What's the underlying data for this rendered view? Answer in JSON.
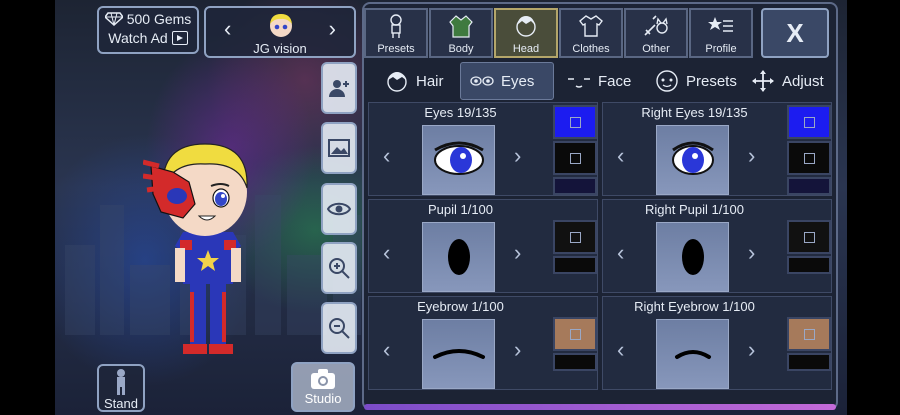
{
  "gems": {
    "count_label": "500 Gems",
    "watch_ad_label": "Watch Ad"
  },
  "character_selector": {
    "name": "JG vision"
  },
  "left_tools": [
    "add-character-icon",
    "background-image-icon",
    "visibility-eye-icon",
    "zoom-in-icon",
    "zoom-out-icon"
  ],
  "stand_label": "Stand",
  "studio_label": "Studio",
  "categories": [
    {
      "label": "Presets",
      "active": false
    },
    {
      "label": "Body",
      "active": false
    },
    {
      "label": "Head",
      "active": true
    },
    {
      "label": "Clothes",
      "active": false
    },
    {
      "label": "Other",
      "active": false
    },
    {
      "label": "Profile",
      "active": false
    }
  ],
  "close_label": "X",
  "subtabs": [
    {
      "label": "Hair",
      "active": false
    },
    {
      "label": "Eyes",
      "active": true
    },
    {
      "label": "Face",
      "active": false
    },
    {
      "label": "Presets",
      "active": false
    },
    {
      "label": "Adjust",
      "active": false
    }
  ],
  "cells": [
    {
      "title": "Eyes 19/135",
      "colors": [
        "#1c1cf0",
        "#0a0a0a",
        "#14143a"
      ]
    },
    {
      "title": "Right Eyes 19/135",
      "colors": [
        "#1c1cf0",
        "#0a0a0a",
        "#14143a"
      ]
    },
    {
      "title": "Pupil 1/100",
      "colors": [
        "#111111",
        "#0a0a0a"
      ]
    },
    {
      "title": "Right Pupil 1/100",
      "colors": [
        "#111111",
        "#0a0a0a"
      ]
    },
    {
      "title": "Eyebrow 1/100",
      "colors": [
        "#b08060",
        "#0a0a0a"
      ]
    },
    {
      "title": "Right Eyebrow 1/100",
      "colors": [
        "#b08060",
        "#0a0a0a"
      ]
    }
  ],
  "nav": {
    "prev": "‹",
    "next": "›"
  }
}
